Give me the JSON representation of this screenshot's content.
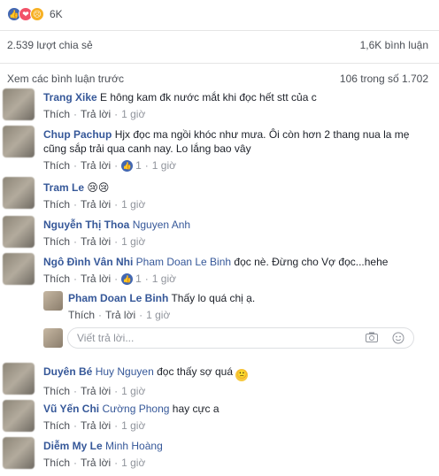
{
  "reactions": {
    "count": "6K",
    "icons": [
      "like-icon",
      "love-icon",
      "sad-icon"
    ]
  },
  "shares": {
    "left": "2.539 lượt chia sẻ",
    "right": "1,6K bình luận"
  },
  "view_previous": {
    "label": "Xem các bình luận trước",
    "pagination": "106 trong số 1.702"
  },
  "actions": {
    "like": "Thích",
    "reply": "Trả lời",
    "sep": "·"
  },
  "comments": [
    {
      "name": "Trang Xike",
      "text": "E hông kam đk nước mắt khi đọc hết stt của c",
      "time": "1 giờ"
    },
    {
      "name": "Chup Pachup",
      "text": "Hjx đọc ma ngồi khóc như mưa. Ôi còn hơn 2 thang nua la mẹ",
      "text2": "cũng sắp trải qua canh nay. Lo lắng bao vây",
      "likes": "1",
      "time": "1 giờ"
    },
    {
      "name": "Tram Le",
      "text": "😢😢",
      "time": "1 giờ"
    },
    {
      "name": "Nguyễn Thị Thoa",
      "tag": "Nguyen Anh",
      "time": "1 giờ"
    },
    {
      "name": "Ngô Đình Vân Nhi",
      "tag": "Pham Doan Le Binh",
      "text": "đọc nè. Đừng cho Vợ đọc...hehe",
      "likes": "1",
      "time": "1 giờ"
    },
    {
      "name": "Pham Doan Le Binh",
      "text": "Thấy lo quá chị ạ.",
      "time": "1 giờ"
    },
    {
      "name": "Duyên Bé",
      "tag": "Huy Nguyen",
      "text": "đọc thấy sợ quá",
      "emoji": "🙁",
      "time": "1 giờ"
    },
    {
      "name": "Vũ Yến Chi",
      "tag": "Cường Phong",
      "text": "hay cực a",
      "time": "1 giờ"
    },
    {
      "name": "Diễm My Le",
      "tag": "Minh Hoàng",
      "time": "1 giờ"
    }
  ],
  "reply_placeholder": "Viết trả lời...",
  "colors": {
    "link": "#365899",
    "like_blue": "#4267b2",
    "muted": "#90949c"
  }
}
